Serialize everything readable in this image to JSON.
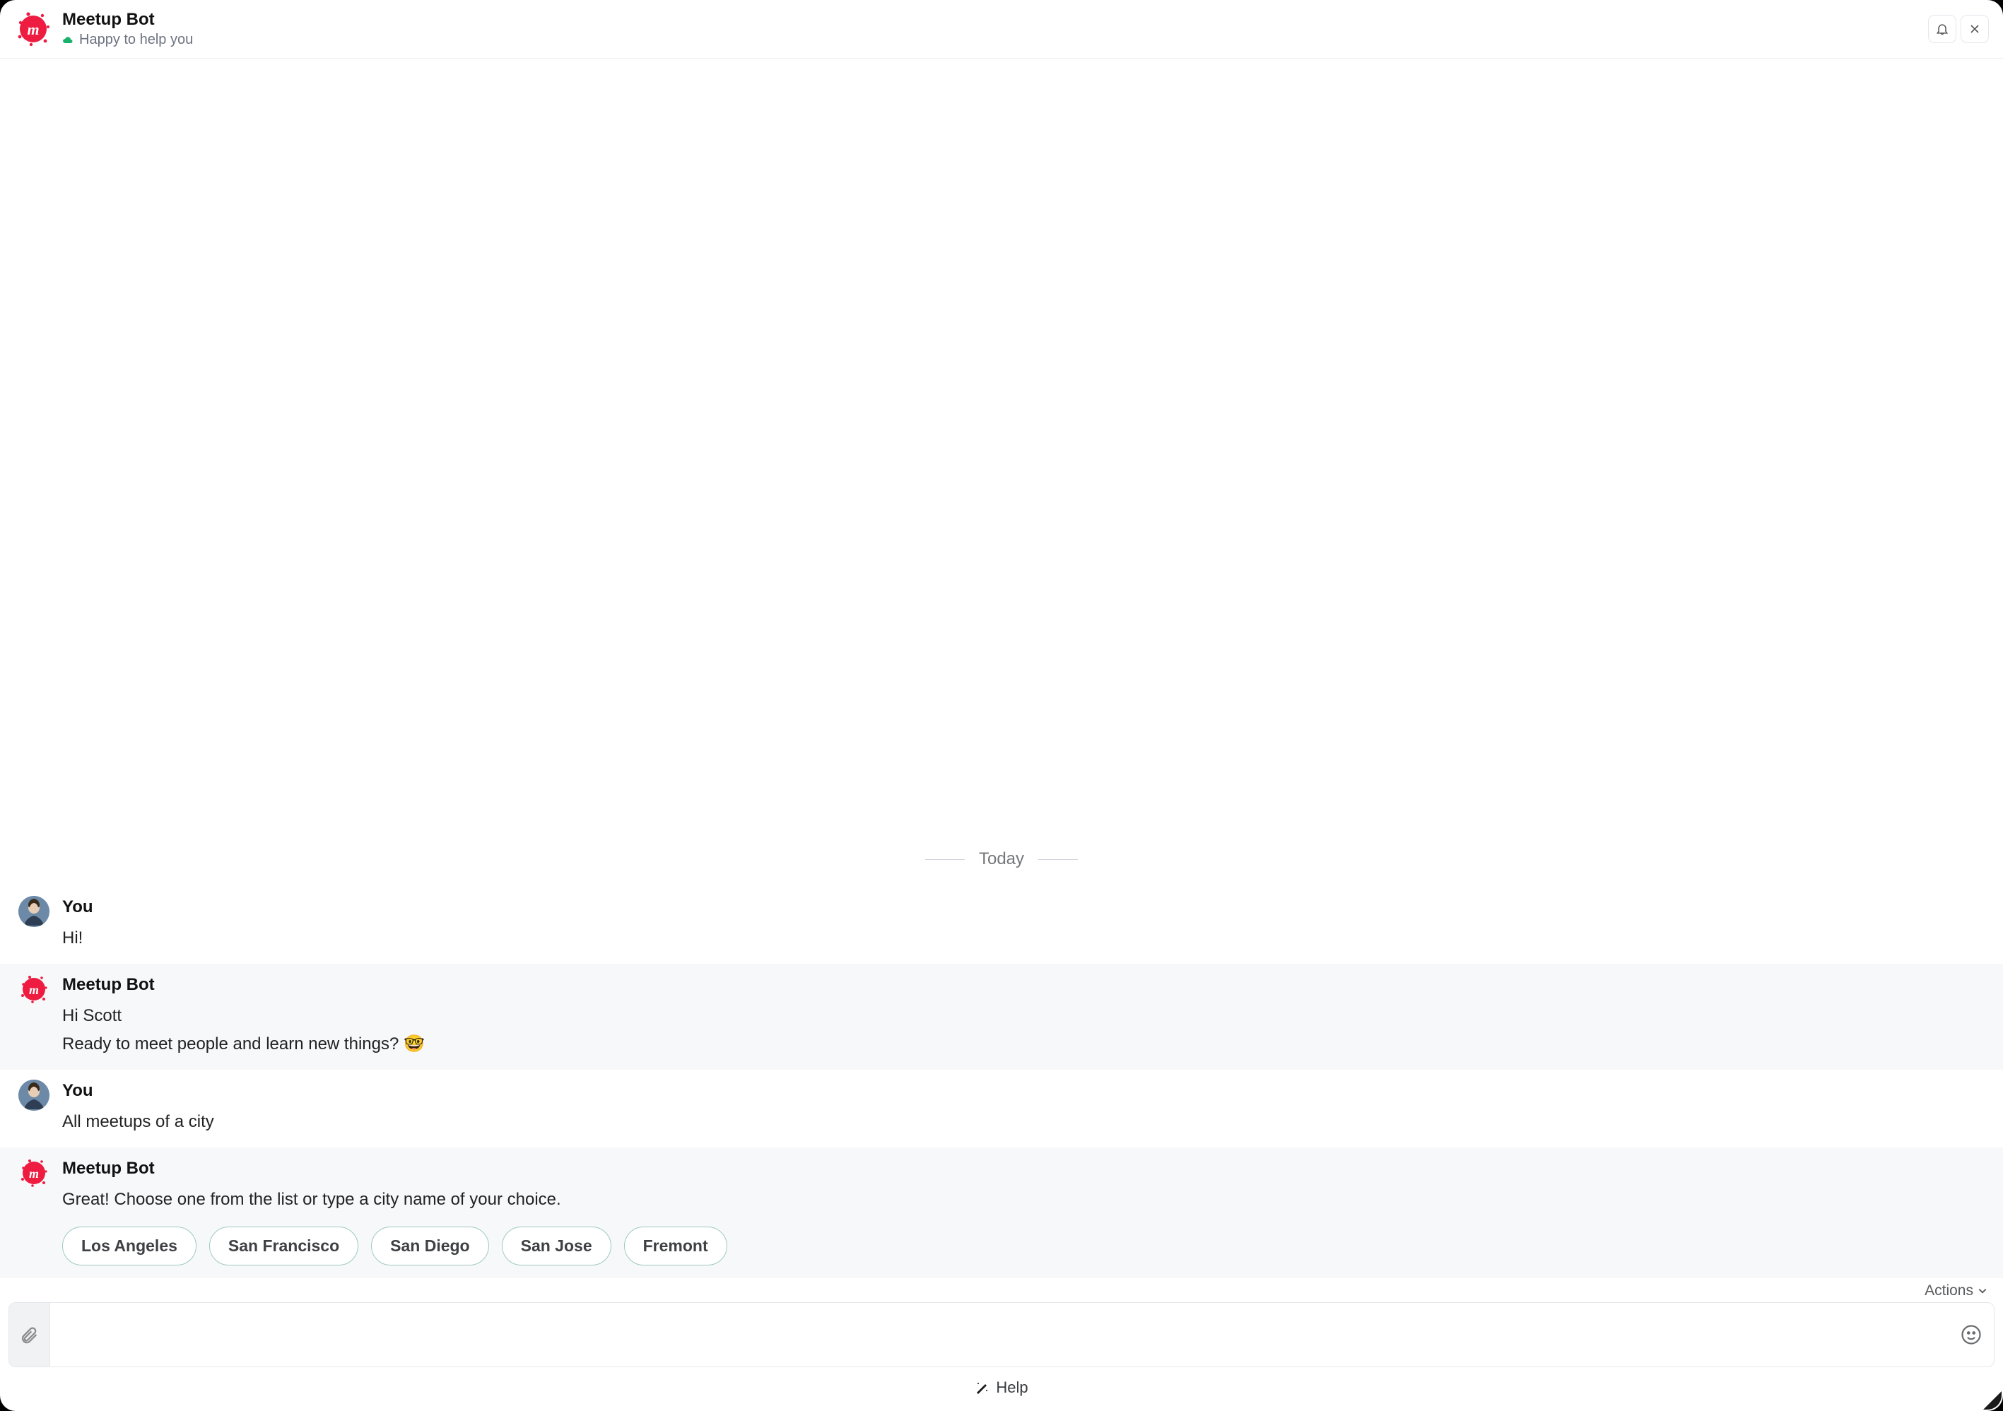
{
  "header": {
    "title": "Meetup Bot",
    "status_text": "Happy to help you"
  },
  "date_separator": "Today",
  "senders": {
    "you": "You",
    "bot": "Meetup Bot"
  },
  "messages": [
    {
      "from": "you",
      "lines": [
        "Hi!"
      ]
    },
    {
      "from": "bot",
      "lines": [
        "Hi Scott",
        "Ready to meet people and learn new things? 🤓"
      ]
    },
    {
      "from": "you",
      "lines": [
        "All meetups of a city"
      ]
    },
    {
      "from": "bot",
      "lines": [
        "Great! Choose one from the list or type a city name of your choice."
      ],
      "chips": [
        "Los Angeles",
        "San Francisco",
        "San Diego",
        "San Jose",
        "Fremont"
      ]
    }
  ],
  "actions_label": "Actions",
  "composer": {
    "placeholder": ""
  },
  "footer": {
    "help_label": "Help"
  }
}
